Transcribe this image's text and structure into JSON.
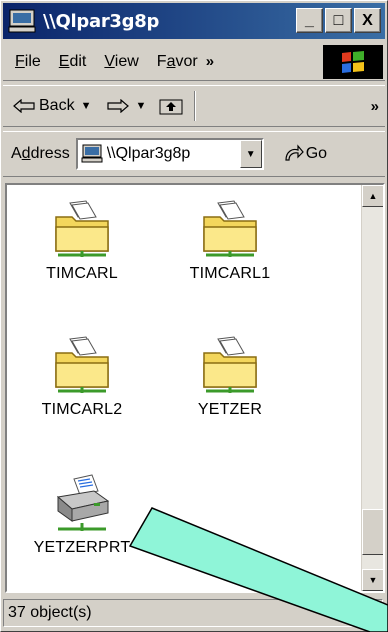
{
  "window": {
    "title": "\\\\Qlpar3g8p",
    "buttons": {
      "minimize": "_",
      "maximize": "□",
      "close": "X"
    }
  },
  "menu": {
    "items": [
      {
        "pre": "",
        "key": "F",
        "post": "ile"
      },
      {
        "pre": "",
        "key": "E",
        "post": "dit"
      },
      {
        "pre": "",
        "key": "V",
        "post": "iew"
      },
      {
        "pre": "F",
        "key": "a",
        "post": "vor"
      }
    ],
    "overflow": "»"
  },
  "toolbar": {
    "back_label": "Back",
    "overflow": "»"
  },
  "address": {
    "label_pre": "A",
    "label_key": "d",
    "label_post": "dress",
    "value": "\\\\Qlpar3g8p",
    "go_label": "Go"
  },
  "items": [
    {
      "label": "TIMCARL",
      "icon": "shared-folder-icon"
    },
    {
      "label": "TIMCARL1",
      "icon": "shared-folder-icon"
    },
    {
      "label": "TIMCARL2",
      "icon": "shared-folder-icon"
    },
    {
      "label": "YETZER",
      "icon": "shared-folder-icon"
    },
    {
      "label": "YETZERPRT",
      "icon": "shared-printer-icon"
    }
  ],
  "status": {
    "text": "37 object(s)"
  },
  "colors": {
    "title_gradient_start": "#0a246a",
    "title_gradient_end": "#3a6ea5",
    "chrome": "#d4d0c8",
    "annotation_fill": "#8ff5d8"
  }
}
